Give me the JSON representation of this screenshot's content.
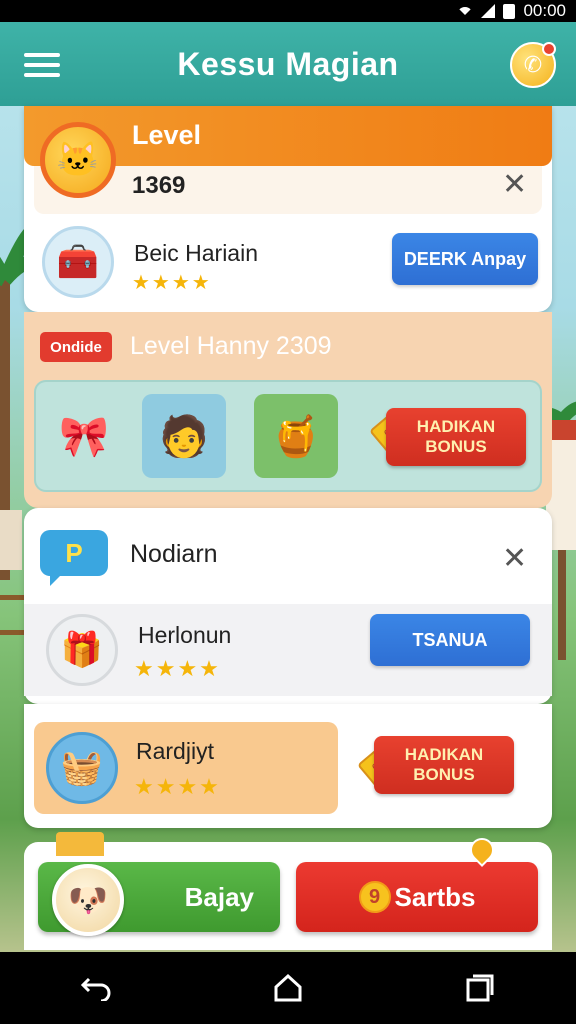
{
  "status_bar": {
    "time": "00:00"
  },
  "app_bar": {
    "title": "Kessu Magian"
  },
  "level_card": {
    "label": "Level",
    "number": "1369",
    "item": {
      "name": "Beic Hariain",
      "stars": "★★★★",
      "button": "DEERK Anpay"
    }
  },
  "new_band": {
    "badge": "Ondide",
    "title": "Level Hanny 2309",
    "bonus_button": "HADIKAN\nBONUS"
  },
  "notification_card": {
    "title": "Nodiarn",
    "item": {
      "name": "Herlonun",
      "stars": "★★★★",
      "button": "TSANUA"
    }
  },
  "reward_row": {
    "name": "Rardjiyt",
    "stars": "★★★★",
    "bonus_button": "HADIKAN\nBONUS"
  },
  "actions": {
    "green_button": "Bajay",
    "red_button": "Sartbs",
    "red_button_coin": "9"
  },
  "colors": {
    "app_bar": "#3fb3a8",
    "level_header": "#f39a2c",
    "blue_button": "#2e6fd4",
    "red_button": "#d4241c",
    "green_button": "#3f9a2f"
  },
  "icons": {
    "menu": "hamburger-icon",
    "phone": "phone-icon",
    "close": "close-icon",
    "back": "back-icon",
    "home": "home-icon",
    "recents": "recents-icon"
  }
}
